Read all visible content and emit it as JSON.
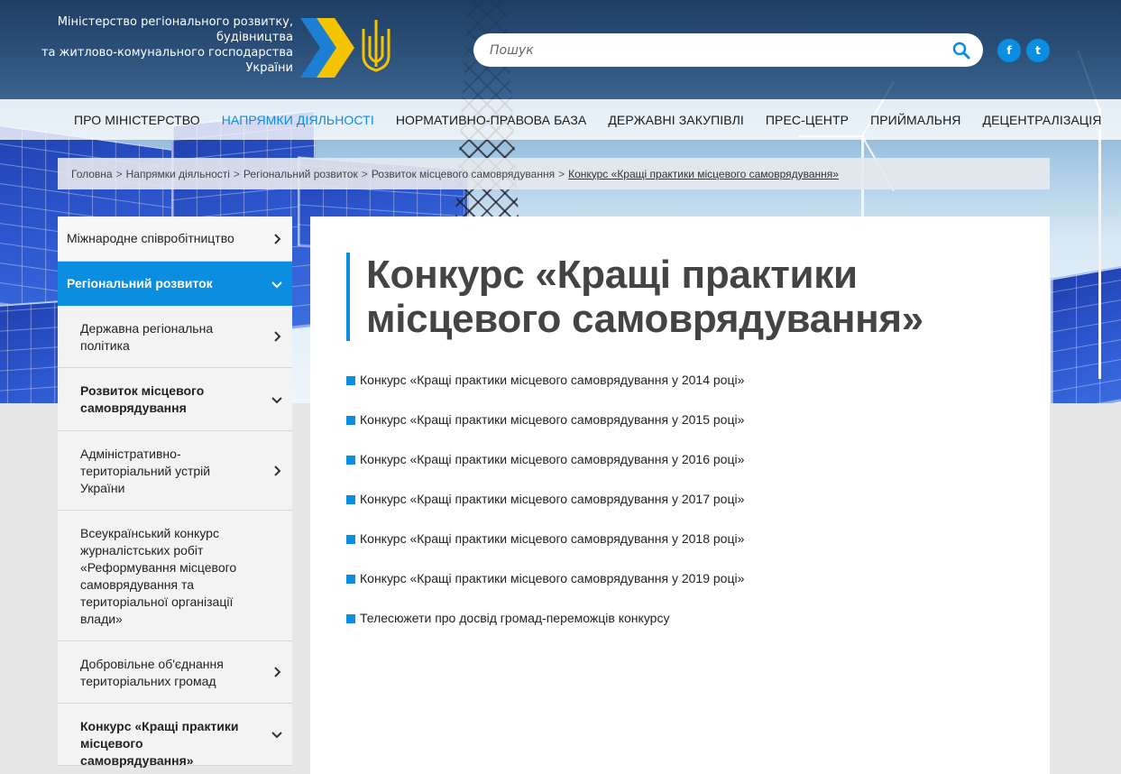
{
  "header": {
    "logo_lines": [
      "Міністерство регіонального розвитку,",
      "будівництва",
      "та житлово-комунального господарства",
      "України"
    ],
    "search_placeholder": "Пошук",
    "social": {
      "facebook": "f",
      "twitter": "t"
    }
  },
  "nav": {
    "items": [
      {
        "label": "Про Міністерство"
      },
      {
        "label": "Напрямки діяльності",
        "active": true
      },
      {
        "label": "Нормативно-правова база"
      },
      {
        "label": "Державні закупівлі"
      },
      {
        "label": "Прес-центр"
      },
      {
        "label": "Приймальня"
      },
      {
        "label": "Децентралізація"
      }
    ]
  },
  "breadcrumb": [
    "Головна",
    "Напрямки діяльності",
    "Регіональний розвиток",
    "Розвиток місцевого самоврядування",
    "Конкурс «Кращі практики місцевого самоврядування»"
  ],
  "sidebar": {
    "top": "Міжнародне співробітництво",
    "active": "Регіональний розвиток",
    "sub": [
      "Державна регіональна політика",
      "Розвиток місцевого самоврядування",
      "Адміністративно-територіальний устрій України",
      "Всеукраїнський конкурс журналістських робіт «Реформування місцевого самоврядування та територіальної організації влади»",
      "Добровільне об'єднання територіальних громад",
      "Конкурс «Кращі практики місцевого самоврядування»"
    ]
  },
  "content": {
    "title": "Конкурс «Кращі практики місцевого самоврядування»",
    "links": [
      "Конкурс «Кращі практики місцевого самоврядування у 2014 році»",
      "Конкурс «Кращі практики місцевого самоврядування у 2015 році»",
      "Конкурс «Кращі практики місцевого самоврядування у 2016 році»",
      "Конкурс «Кращі практики місцевого самоврядування у 2017 році»",
      "Конкурс «Кращі практики місцевого самоврядування у 2018 році»",
      "Конкурс «Кращі практики місцевого самоврядування у 2019 році»",
      "Телесюжети про досвід громад-переможців конкурсу"
    ]
  },
  "colors": {
    "accent": "#0b8de0",
    "logo_yellow": "#f5c400",
    "logo_blue": "#1d7fd4"
  }
}
